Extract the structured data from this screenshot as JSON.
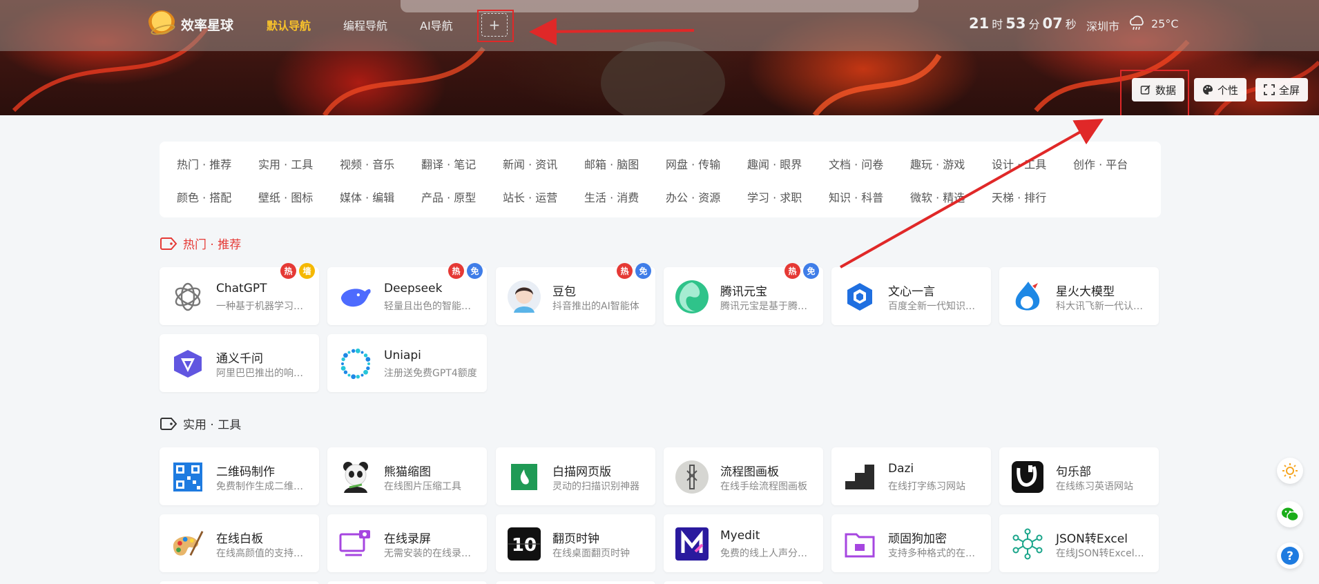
{
  "header": {
    "logo_text": "效率星球",
    "tabs": [
      {
        "label": "默认导航",
        "active": true
      },
      {
        "label": "编程导航",
        "active": false
      },
      {
        "label": "AI导航",
        "active": false
      }
    ],
    "add_tab_label": "+",
    "clock": {
      "hour": "21",
      "h_unit": "时",
      "minute": "53",
      "m_unit": "分",
      "second": "07",
      "s_unit": "秒"
    },
    "weather": {
      "city": "深圳市",
      "temp": "25°C",
      "icon": "rain-cloud-icon"
    }
  },
  "banner_buttons": {
    "data": "数据",
    "style": "个性",
    "fullscreen": "全屏"
  },
  "categories": {
    "row1": [
      "热门 · 推荐",
      "实用 · 工具",
      "视频 · 音乐",
      "翻译 · 笔记",
      "新闻 · 资讯",
      "邮箱 · 脑图",
      "网盘 · 传输",
      "趣闻 · 眼界",
      "文档 · 问卷",
      "趣玩 · 游戏",
      "设计 · 工具",
      "创作 · 平台"
    ],
    "row2": [
      "颜色 · 搭配",
      "壁纸 · 图标",
      "媒体 · 编辑",
      "产品 · 原型",
      "站长 · 运营",
      "生活 · 消费",
      "办公 · 资源",
      "学习 · 求职",
      "知识 · 科普",
      "微软 · 精选",
      "天梯 · 排行"
    ]
  },
  "sections": {
    "hot": {
      "title": "热门 · 推荐",
      "cards": [
        {
          "name": "ChatGPT",
          "desc": "一种基于机器学习的聊天机器人",
          "badges": [
            "热",
            "墙"
          ]
        },
        {
          "name": "Deepseek",
          "desc": "轻量且出色的智能助手",
          "badges": [
            "热",
            "免"
          ]
        },
        {
          "name": "豆包",
          "desc": "抖音推出的AI智能体",
          "badges": [
            "热",
            "免"
          ]
        },
        {
          "name": "腾讯元宝",
          "desc": "腾讯元宝是基于腾讯混元大模型",
          "badges": [
            "热",
            "免"
          ]
        },
        {
          "name": "文心一言",
          "desc": "百度全新一代知识增强大语言模型",
          "badges": []
        },
        {
          "name": "星火大模型",
          "desc": "科大讯飞新一代认知智能大模型",
          "badges": []
        },
        {
          "name": "通义千问",
          "desc": "阿里巴巴推出的响应式AI",
          "badges": []
        },
        {
          "name": "Uniapi",
          "desc": "注册送免费GPT4额度",
          "badges": []
        }
      ]
    },
    "tools": {
      "title": "实用 · 工具",
      "cards": [
        {
          "name": "二维码制作",
          "desc": "免费制作生成二维码工具"
        },
        {
          "name": "熊猫缩图",
          "desc": "在线图片压缩工具"
        },
        {
          "name": "白描网页版",
          "desc": "灵动的扫描识别神器"
        },
        {
          "name": "流程图画板",
          "desc": "在线手绘流程图画板"
        },
        {
          "name": "Dazi",
          "desc": "在线打字练习网站"
        },
        {
          "name": "句乐部",
          "desc": "在线练习英语网站"
        },
        {
          "name": "在线白板",
          "desc": "在线高颜值的支持多人协作白板"
        },
        {
          "name": "在线录屏",
          "desc": "无需安装的在线录屏工具"
        },
        {
          "name": "翻页时钟",
          "desc": "在线桌面翻页时钟"
        },
        {
          "name": "Myedit",
          "desc": "免费的线上人声分离工具"
        },
        {
          "name": "顽固狗加密",
          "desc": "支持多种格式的在线加密"
        },
        {
          "name": "JSON转Excel",
          "desc": "在线JSON转Excel工具"
        }
      ]
    }
  },
  "colors": {
    "accent": "#f7c12b",
    "hot_red": "#e53935",
    "badge_blue": "#3f7de8",
    "badge_yellow": "#f5b800",
    "annotation_red": "#e02828"
  }
}
